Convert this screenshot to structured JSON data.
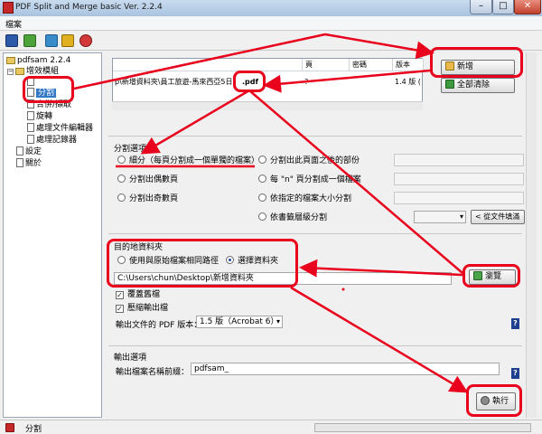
{
  "window": {
    "title": "PDF Split and Merge basic Ver. 2.2.4"
  },
  "menu": {
    "file": "檔案"
  },
  "tree": {
    "root": "pdfsam 2.2.4",
    "modules": "增效模組",
    "items": [
      "分割",
      "合併/擷取",
      "旋轉",
      "處理文件編輯器",
      "處理記錄器"
    ],
    "settings": "設定",
    "about": "關於"
  },
  "table": {
    "headers": [
      "頁",
      "密碼",
      "版本"
    ],
    "row": {
      "path": "p\\新增資料夾\\員工旅遊-馬來西亞5日",
      "ext": ".pdf",
      "pages": "?",
      "version": "1.4 版 ("
    }
  },
  "buttons": {
    "add": "新增",
    "clear": "全部清除",
    "browse": "瀏覽",
    "run": "執行"
  },
  "split": {
    "title": "分割選項",
    "burst": "細分（每頁分割成一個單獨的檔案）",
    "even": "分割出偶數頁",
    "odd": "分割出奇數頁",
    "after": "分割出此頁面之後的部份",
    "every_n": "每 \"n\" 頁分割成一個檔案",
    "by_size": "依指定的檔案大小分割",
    "bookmark": "依書籤層級分割",
    "level_placeholder": "< 從文件填滿"
  },
  "dest": {
    "title": "目的地資料夾",
    "same": "使用與原始檔案相同路徑",
    "choose": "選擇資料夾",
    "path": "C:\\Users\\chun\\Desktop\\新增資料夾",
    "overwrite": "覆蓋舊檔",
    "compress": "壓縮輸出檔",
    "version_label": "輸出文件的 PDF 版本：",
    "version_value": "1.5 版（Acrobat 6）"
  },
  "output": {
    "title": "輸出選項",
    "prefix_label": "輸出檔案名稱前綴：",
    "prefix_value": "pdfsam_"
  },
  "status": {
    "text": "分割"
  },
  "help": "?"
}
